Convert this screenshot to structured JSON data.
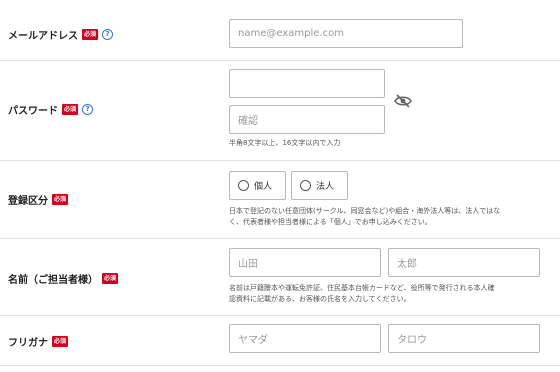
{
  "email": {
    "label": "メールアドレス",
    "required": "必須",
    "help": "?",
    "placeholder": "name@example.com"
  },
  "password": {
    "label": "パスワード",
    "required": "必須",
    "help": "?",
    "password_value": "",
    "confirm_placeholder": "確認",
    "note": "半角8文字以上、16文字以内で入力",
    "visibility_icon": "eye-off-icon"
  },
  "registration_type": {
    "label": "登録区分",
    "required": "必須",
    "options": [
      "個人",
      "法人"
    ],
    "note_line1": "日本で登記のない任意団体(サークル、同窓会など)や組合・海外法人等は、法人ではな",
    "note_line2": "く、代表者様や担当者様による「個人」でお申し込みください。"
  },
  "name": {
    "label": "名前（ご担当者様）",
    "required": "必須",
    "last_placeholder": "山田",
    "first_placeholder": "太郎",
    "note_line1": "名前は戸籍謄本や運転免許証、住民基本台帳カードなど、役所等で発行される本人確",
    "note_line2": "認資料に記載がある、お客様の氏名を入力してください。"
  },
  "furigana": {
    "label": "フリガナ",
    "required": "必須",
    "last_placeholder": "ヤマダ",
    "first_placeholder": "タロウ"
  },
  "colors": {
    "required_badge": "#d9001b",
    "help_icon": "#3a6fcf",
    "border": "#b8b8b8",
    "divider": "#dddddd"
  }
}
